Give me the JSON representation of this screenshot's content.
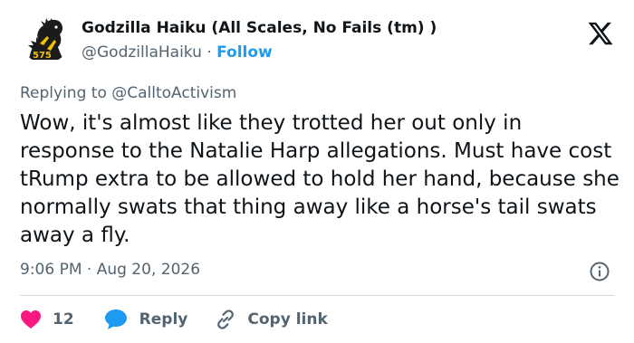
{
  "author": {
    "display_name": "Godzilla Haiku (All Scales, No Fails (tm) )",
    "handle": "@GodzillaHaiku",
    "separator": "·",
    "follow_label": "Follow"
  },
  "replying": {
    "prefix": "Replying to",
    "mention": "@CalltoActivism"
  },
  "tweet": {
    "text": "Wow, it's almost like they trotted her out only in response to the Natalie Harp allegations. Must have cost tRump extra to be allowed to hold her hand, because she normally swats that thing away like a horse's tail swats away a fly.",
    "timestamp": "9:06 PM · Aug 20, 2026"
  },
  "actions": {
    "like_count": "12",
    "reply_label": "Reply",
    "copy_label": "Copy link"
  },
  "colors": {
    "like": "#f91880",
    "reply": "#1d9bf0",
    "link": "#1d9bf0",
    "muted": "#536471"
  },
  "icons": {
    "platform": "x-logo-icon",
    "like": "heart-icon",
    "reply": "reply-bubble-icon",
    "copy": "link-icon",
    "info": "info-icon"
  }
}
